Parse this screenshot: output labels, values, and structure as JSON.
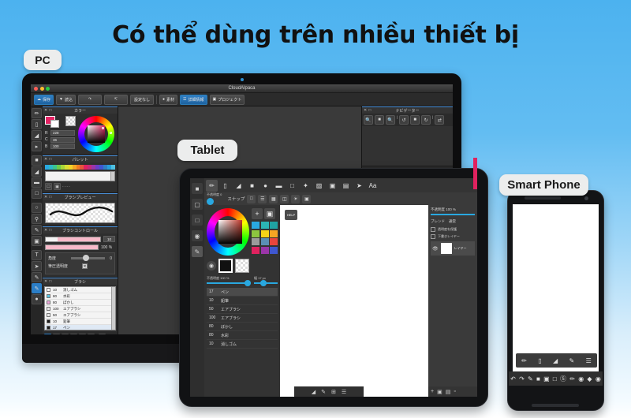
{
  "page": {
    "title": "Có thể dùng trên nhiều thiết bị",
    "background_top_color": "#4cb2ef",
    "background_bottom_color": "#ffffff"
  },
  "labels": {
    "pc": "PC",
    "tablet": "Tablet",
    "smart_phone": "Smart Phone"
  },
  "pc": {
    "window_title": "CloudAlpaca",
    "menubar": [
      {
        "label": "保存",
        "icon": "cloud-icon",
        "active": true
      },
      {
        "label": "読込",
        "icon": "download-icon",
        "active": false
      },
      {
        "label": "",
        "icon": "undo-icon",
        "active": false
      },
      {
        "label": "",
        "icon": "redo-icon",
        "active": false
      },
      {
        "label": "設定なし",
        "icon": "",
        "active": false
      },
      {
        "label": "素材",
        "icon": "speech-icon",
        "active": false
      },
      {
        "label": "詳細情報",
        "icon": "info-icon",
        "active": true
      },
      {
        "label": "プロジェクト",
        "icon": "project-icon",
        "active": false
      }
    ],
    "tools": [
      "pen-icon",
      "eraser-icon",
      "blur-icon",
      "select-arrow-icon",
      "fill-square-icon",
      "bucket-icon",
      "gradient-icon",
      "frame-icon",
      "lasso-icon",
      "eyedropper-icon",
      "brush-icon",
      "stamp-icon",
      "text-icon",
      "move-arrow-icon",
      "pencil-icon",
      "highlight-brush-icon",
      "paint-bucket-icon"
    ],
    "selected_tool": "highlight-brush-icon",
    "color_panel": {
      "title": "カラー",
      "foreground_color": "#e42464",
      "background_color": "#ffffff",
      "fields": [
        {
          "label": "R",
          "value": "228"
        },
        {
          "label": "C",
          "value": "36"
        },
        {
          "label": "B",
          "value": "100"
        }
      ]
    },
    "palette_panel": {
      "title": "パレット",
      "swatches": [
        "#29a8e0",
        "#2fb8c8",
        "#3cc48f",
        "#6ecb4a",
        "#a8d63a",
        "#d9de33",
        "#f2d22a",
        "#f5a623",
        "#f07c23",
        "#e8553c",
        "#e0225f",
        "#c32a7a",
        "#9a35a8",
        "#6a3ec8",
        "#3f57d0",
        "#2f7fc4",
        "#27a0d8",
        "#4fbfe0"
      ],
      "buttons": [
        "new-icon",
        "delete-icon"
      ],
      "meta_text": "- - - -"
    },
    "brush_preview_panel": {
      "title": "ブラシプレビュー"
    },
    "brush_control_panel": {
      "title": "ブラシコントロール",
      "size_value": "10",
      "opacity_value": "100 %",
      "angle_label": "角度",
      "angle_value": "0",
      "pressure_label": "筆圧透明度"
    },
    "brush_panel": {
      "title": "ブラシ",
      "items": [
        {
          "size": "17",
          "name": "ペン",
          "color": "#1a1a1a",
          "selected": true
        },
        {
          "size": "10",
          "name": "鉛筆",
          "color": "#1a1a1a",
          "selected": false
        },
        {
          "size": "50",
          "name": "エアブラシ",
          "color": "#e8e8e8",
          "selected": false
        },
        {
          "size": "100",
          "name": "エアブラシ",
          "color": "#e8e8e8",
          "selected": false
        },
        {
          "size": "80",
          "name": "ぼかし",
          "color": "#f0a8dd",
          "selected": false
        },
        {
          "size": "80",
          "name": "水彩",
          "color": "#57c8e8",
          "selected": false
        },
        {
          "size": "10",
          "name": "消しゴム",
          "color": "#ffffff",
          "selected": false
        }
      ],
      "bottom_buttons": [
        "bucket-icon",
        "new-file-icon",
        "duplicate-icon",
        "copy-icon",
        "folder-icon",
        "link-icon",
        "trash-icon"
      ]
    },
    "navigator_panel": {
      "title": "ナビゲーター",
      "buttons": [
        "zoom-in-icon",
        "fit-icon",
        "zoom-out-icon",
        "rotate-left-icon",
        "reset-icon",
        "rotate-right-icon",
        "flip-icon"
      ]
    }
  },
  "tablet": {
    "rail_tools": [
      "menu-icon",
      "file-icon",
      "frame-icon",
      "layers-icon",
      "brush-icon"
    ],
    "toolbar": [
      "pen-icon",
      "eraser-icon",
      "blur-icon",
      "fill-square-icon",
      "bucket-icon",
      "gradient-icon",
      "select-rect-icon",
      "wand-icon",
      "transform-icon",
      "copy-icon",
      "image-icon",
      "move-arrow-icon",
      "text-icon"
    ],
    "selected_tool": "pen-icon",
    "opacity_mini_label": "不透明度 0",
    "snap": {
      "label": "スナップ",
      "buttons": [
        "snap-off-icon",
        "snap-parallel-icon",
        "snap-grid-icon",
        "snap-perspective-icon",
        "snap-radial-icon",
        "snap-symmetry-icon"
      ]
    },
    "color": {
      "foreground_color": "#111111",
      "background_color": "#ffffff",
      "add_button": "+",
      "delete_button": "trash-icon",
      "grid_swatches": [
        "#29a8e0",
        "#2bb5b5",
        "#1fa3a3",
        "#8cc63f",
        "#f7d417",
        "#f5a623",
        "#9b9b9b",
        "#5a8fb5",
        "#e8453c",
        "#e0225f",
        "#9a35a8",
        "#3f57d0"
      ]
    },
    "sliders": [
      {
        "label": "不透明度 100 %",
        "value": 100
      },
      {
        "label": "幅 17 px",
        "value": 17
      }
    ],
    "brush_list": [
      {
        "size": "17",
        "name": "ペン",
        "selected": true
      },
      {
        "size": "10",
        "name": "鉛筆",
        "selected": false
      },
      {
        "size": "50",
        "name": "エアブラシ",
        "selected": false
      },
      {
        "size": "100",
        "name": "エアブラシ",
        "selected": false
      },
      {
        "size": "80",
        "name": "ぼかし",
        "selected": false
      },
      {
        "size": "80",
        "name": "水彩",
        "selected": false
      },
      {
        "size": "10",
        "name": "消しゴム",
        "selected": false
      }
    ],
    "brush_actions": [
      "add-brush-icon",
      "delete-brush-icon",
      "up-icon",
      "down-icon"
    ],
    "canvas_badge": "HELP",
    "layer_panel": {
      "opacity_label": "不透明度 100 %",
      "blend_label": "ブレンド",
      "blend_value": "通常",
      "protect_alpha_label": "透明度を保護",
      "draft_layer_label": "下書きレイヤー",
      "layer_name": "レイヤー"
    },
    "status_bar": [
      "undo-icon",
      "redo-icon",
      "move-icon",
      "menu-icon"
    ]
  },
  "phone": {
    "toolbar_row1": [
      "pen-icon",
      "eraser-icon",
      "blur-icon",
      "eyedropper-icon",
      "layers-icon"
    ],
    "toolbar_row2": [
      "undo-icon",
      "redo-icon",
      "pencil-icon",
      "fill-square-icon",
      "file-icon",
      "select-rect-icon",
      "transparency-icon",
      "brush-icon",
      "palette-icon",
      "shape-icon",
      "settings-icon"
    ]
  }
}
